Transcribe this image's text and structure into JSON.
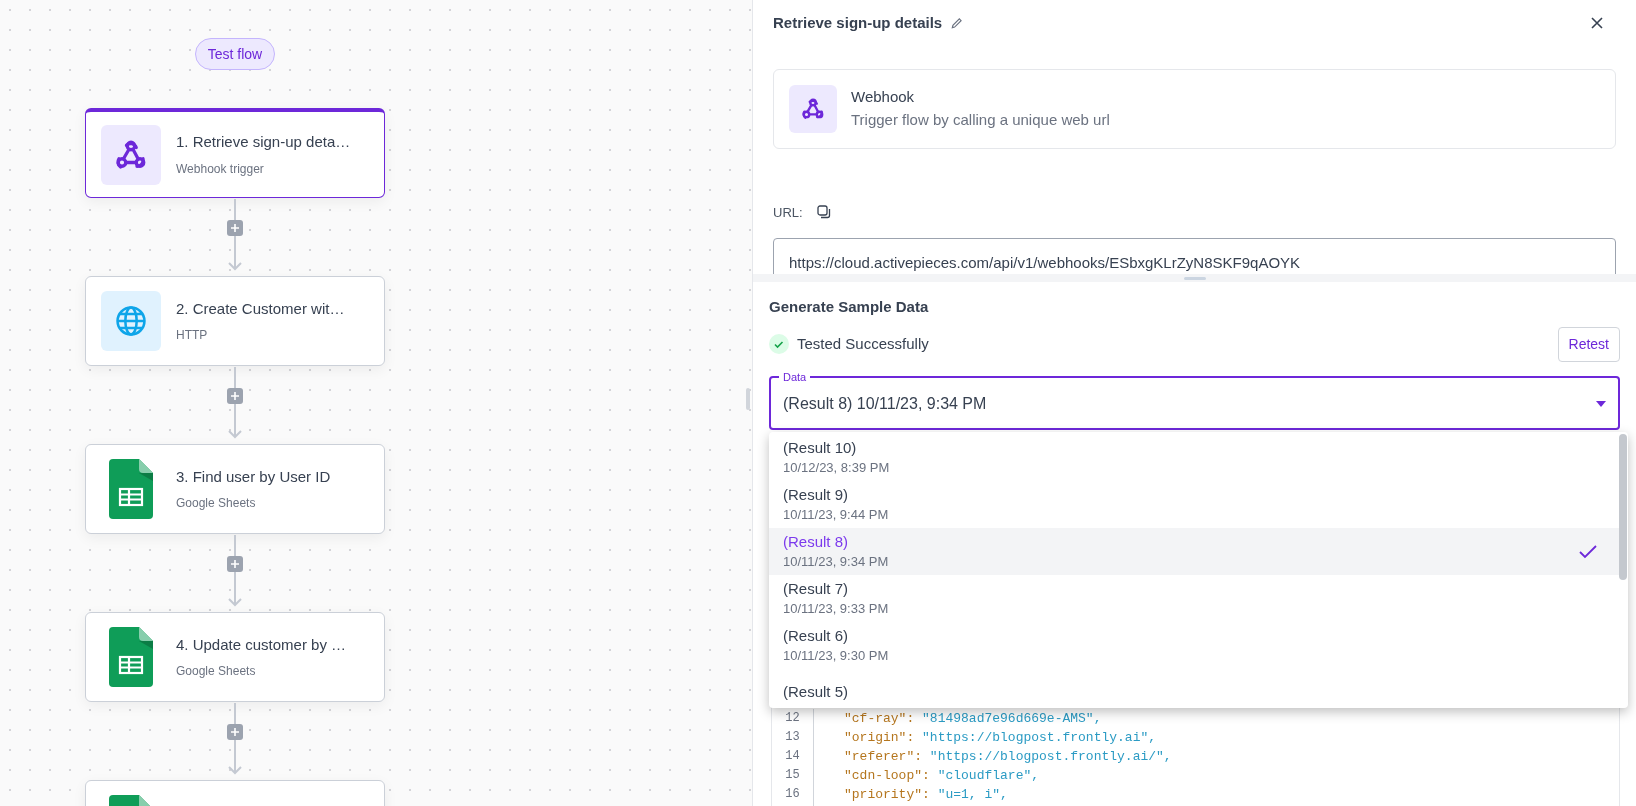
{
  "test_flow_button": "Test flow",
  "steps": [
    {
      "kind": "webhook",
      "title": "1. Retrieve sign-up deta…",
      "subtitle": "Webhook trigger",
      "selected": true
    },
    {
      "kind": "http",
      "title": "2. Create Customer wit…",
      "subtitle": "HTTP",
      "selected": false
    },
    {
      "kind": "sheets",
      "title": "3. Find user by User ID",
      "subtitle": "Google Sheets",
      "selected": false
    },
    {
      "kind": "sheets",
      "title": "4. Update customer by …",
      "subtitle": "Google Sheets",
      "selected": false
    },
    {
      "kind": "sheets",
      "selected": false
    }
  ],
  "panel": {
    "title": "Retrieve sign-up details",
    "piece": {
      "name": "Webhook",
      "description": "Trigger flow by calling a unique web url"
    },
    "url_label": "URL:",
    "url_value": "https://cloud.activepieces.com/api/v1/webhooks/ESbxgKLrZyN8SKF9qAOYK",
    "sample": {
      "heading": "Generate Sample Data",
      "status": "Tested Successfully",
      "retest": "Retest",
      "data_label": "Data",
      "data_value": "(Result 8) 10/11/23, 9:34 PM",
      "options": [
        {
          "label": "(Result 10)",
          "time": "10/12/23, 8:39 PM",
          "selected": false
        },
        {
          "label": "(Result 9)",
          "time": "10/11/23, 9:44 PM",
          "selected": false
        },
        {
          "label": "(Result 8)",
          "time": "10/11/23, 9:34 PM",
          "selected": true
        },
        {
          "label": "(Result 7)",
          "time": "10/11/23, 9:33 PM",
          "selected": false
        },
        {
          "label": "(Result 6)",
          "time": "10/11/23, 9:30 PM",
          "selected": false
        },
        {
          "label": "(Result 5)",
          "selected": false
        }
      ]
    },
    "code": [
      {
        "number": "12",
        "key": "\"cf-ray\":",
        "value": "\"81498ad7e96d669e-AMS\","
      },
      {
        "number": "13",
        "key": "\"origin\":",
        "value": "\"https://blogpost.frontly.ai\","
      },
      {
        "number": "14",
        "key": "\"referer\":",
        "value": "\"https://blogpost.frontly.ai/\","
      },
      {
        "number": "15",
        "key": "\"cdn-loop\":",
        "value": "\"cloudflare\","
      },
      {
        "number": "16",
        "key": "\"priority\":",
        "value": "\"u=1, i\","
      }
    ]
  }
}
